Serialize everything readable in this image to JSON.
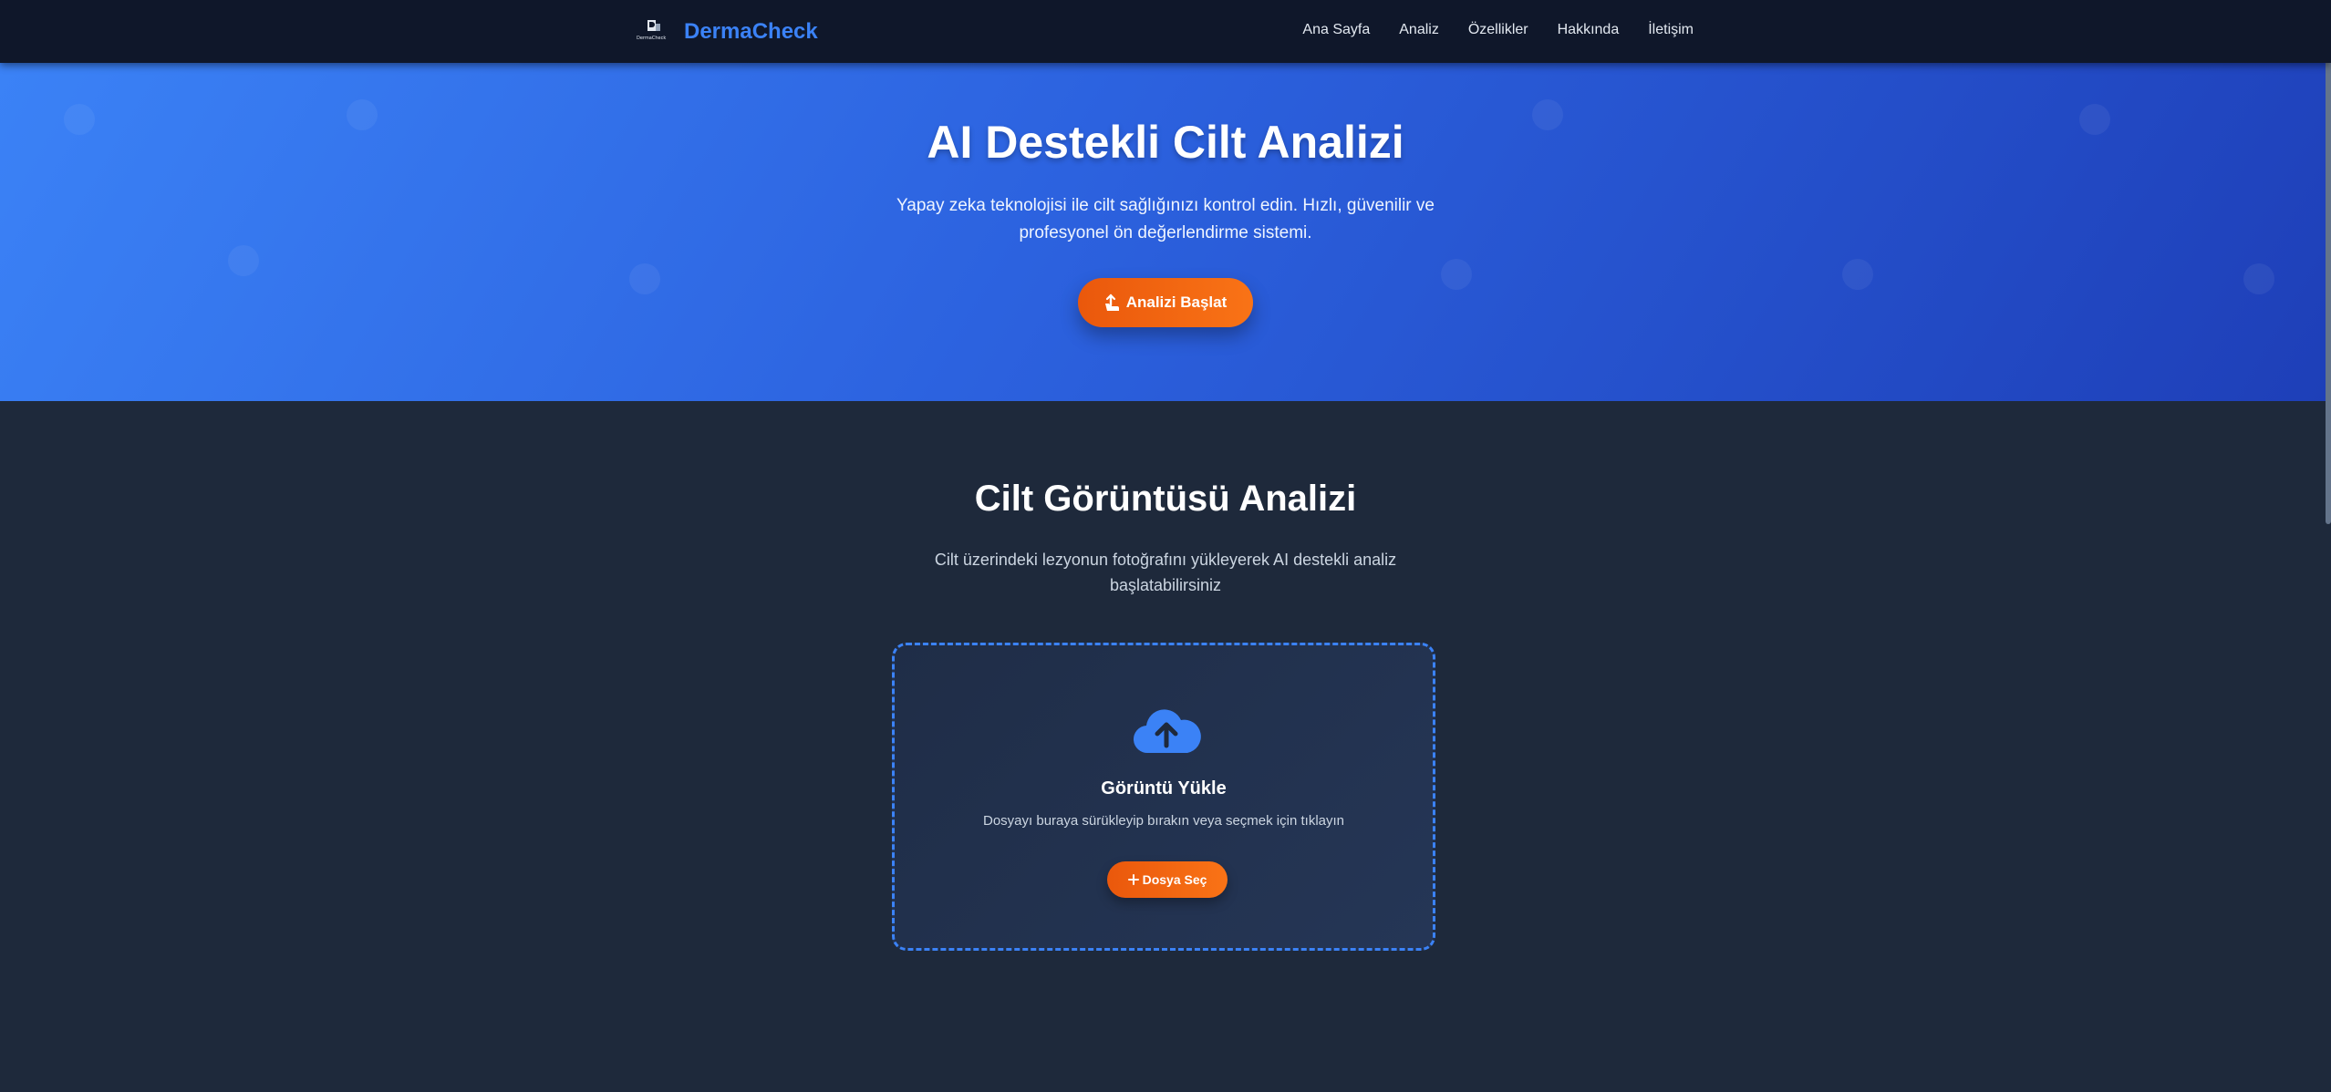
{
  "navbar": {
    "logo_text": "DermaCheck",
    "brand": "DermaCheck",
    "links": [
      "Ana Sayfa",
      "Analiz",
      "Özellikler",
      "Hakkında",
      "İletişim"
    ]
  },
  "hero": {
    "title": "AI Destekli Cilt Analizi",
    "subtitle": "Yapay zeka teknolojisi ile cilt sağlığınızı kontrol edin. Hızlı, güvenilir ve profesyonel ön değerlendirme sistemi.",
    "button_label": "Analizi Başlat",
    "button_icon": "upload-hand-icon"
  },
  "analysis": {
    "title": "Cilt Görüntüsü Analizi",
    "subtitle": "Cilt üzerindeki lezyonun fotoğrafını yükleyerek AI destekli analiz başlatabilirsiniz",
    "upload": {
      "icon": "cloud-upload-icon",
      "title": "Görüntü Yükle",
      "description": "Dosyayı buraya sürükleyip bırakın veya seçmek için tıklayın",
      "button_label": "Dosya Seç",
      "button_icon": "plus-icon"
    }
  },
  "colors": {
    "navbar_bg": "#0f172a",
    "brand": "#3b82f6",
    "hero_gradient_start": "#3b82f6",
    "hero_gradient_end": "#1e3fb8",
    "accent_orange": "#f97316",
    "section_bg": "#1e293b",
    "upload_border": "#3b82f6"
  }
}
